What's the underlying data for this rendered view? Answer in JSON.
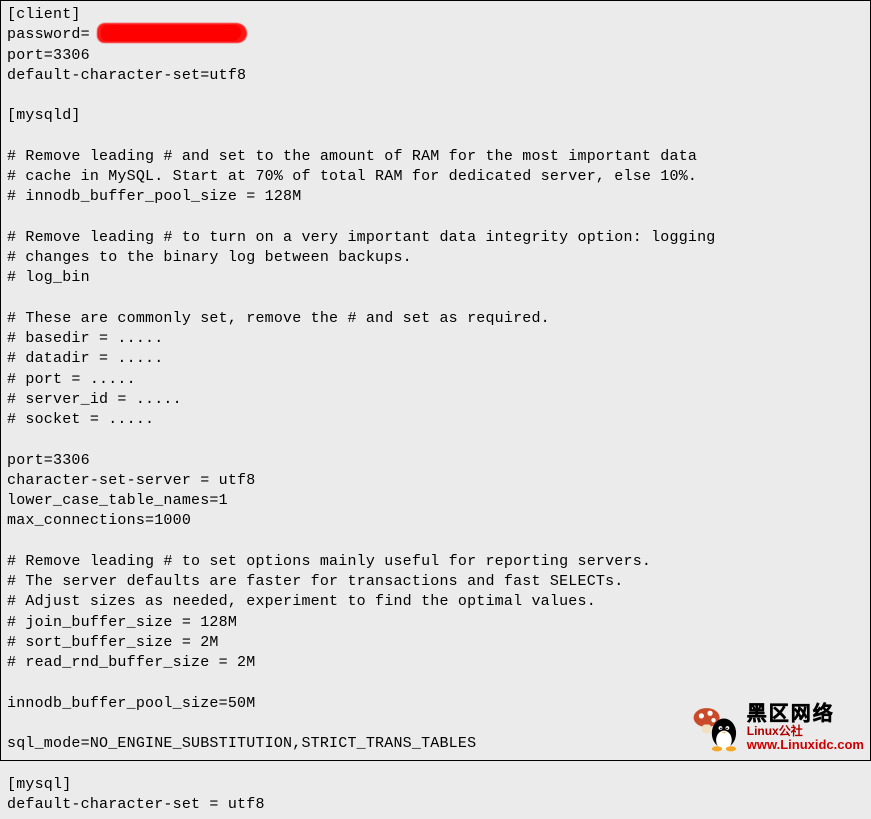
{
  "config_lines": [
    "[client]",
    "password=",
    "port=3306",
    "default-character-set=utf8",
    "",
    "[mysqld]",
    "",
    "# Remove leading # and set to the amount of RAM for the most important data",
    "# cache in MySQL. Start at 70% of total RAM for dedicated server, else 10%.",
    "# innodb_buffer_pool_size = 128M",
    "",
    "# Remove leading # to turn on a very important data integrity option: logging",
    "# changes to the binary log between backups.",
    "# log_bin",
    "",
    "# These are commonly set, remove the # and set as required.",
    "# basedir = .....",
    "# datadir = .....",
    "# port = .....",
    "# server_id = .....",
    "# socket = .....",
    "",
    "port=3306",
    "character-set-server = utf8",
    "lower_case_table_names=1",
    "max_connections=1000",
    "",
    "# Remove leading # to set options mainly useful for reporting servers.",
    "# The server defaults are faster for transactions and fast SELECTs.",
    "# Adjust sizes as needed, experiment to find the optimal values.",
    "# join_buffer_size = 128M",
    "# sort_buffer_size = 2M",
    "# read_rnd_buffer_size = 2M",
    "",
    "innodb_buffer_pool_size=50M",
    "",
    "sql_mode=NO_ENGINE_SUBSTITUTION,STRICT_TRANS_TABLES",
    "",
    "[mysql]",
    "default-character-set = utf8"
  ],
  "watermark": {
    "title_cn": "黑区网络",
    "subtitle": "Linux公社",
    "url": "www.Linuxidc.com"
  }
}
